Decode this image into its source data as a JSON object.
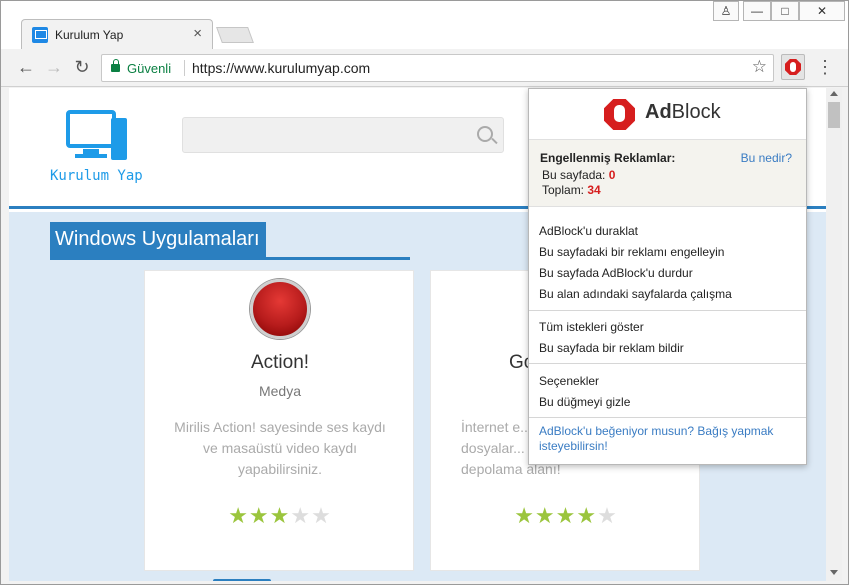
{
  "browser": {
    "tab_title": "Kurulum Yap",
    "tab_close": "×",
    "secure_label": "Güvenli",
    "url": "https://www.kurulumyap.com",
    "back": "←",
    "forward": "→",
    "reload": "↻",
    "star": "☆",
    "menu": "⋮",
    "window_controls": {
      "user": "♙",
      "minimize": "—",
      "maximize": "□",
      "close": "✕"
    }
  },
  "site": {
    "logo_text": "Kurulum Yap",
    "section_title": "Windows Uygulamaları",
    "cards": [
      {
        "name": "Action!",
        "category": "Medya",
        "description": "Mirilis Action! sayesinde ses kaydı ve masaüstü video kaydı yapabilirsiniz.",
        "rating": 3,
        "stars_on": "★★★",
        "stars_off": "★★"
      },
      {
        "name": "Go",
        "category": "",
        "description": "İnternet e... dosyalar... depolama alanı!",
        "rating": 4,
        "stars_on": "★★★★",
        "stars_off": "★"
      }
    ]
  },
  "adblock": {
    "brand_prefix": "Ad",
    "brand_suffix": "Block",
    "stats_title": "Engellenmiş Reklamlar:",
    "help_link": "Bu nedir?",
    "page_label": "Bu sayfada:",
    "page_count": "0",
    "total_label": "Toplam:",
    "total_count": "34",
    "menu": [
      "AdBlock'u duraklat",
      "Bu sayfadaki bir reklamı engelleyin",
      "Bu sayfada AdBlock'u durdur",
      "Bu alan adındaki sayfalarda çalışma",
      "Tüm istekleri göster",
      "Bu sayfada bir reklam bildir",
      "Seçenekler",
      "Bu düğmeyi gizle"
    ],
    "donate": "AdBlock'u beğeniyor musun? Bağış yapmak isteyebilirsin!"
  },
  "colors": {
    "accent": "#2b7fc0",
    "logo_blue": "#1e9be8",
    "adblock_red": "#d61e1e",
    "link_blue": "#3a7cc3",
    "star_green": "#9bc53d"
  }
}
